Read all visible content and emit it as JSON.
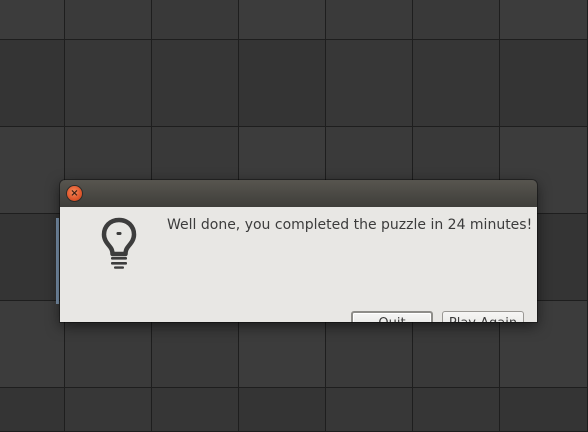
{
  "dialog": {
    "message": "Well done, you completed the puzzle in 24 minutes!",
    "close_symbol": "×",
    "icon": "lightbulb-icon",
    "buttons": {
      "quit_label": "Quit",
      "play_again_label": "Play Again"
    }
  },
  "colors": {
    "close_button": "#e0562b",
    "titlebar": "#4a4944",
    "dialog_body": "#e8e7e4"
  }
}
